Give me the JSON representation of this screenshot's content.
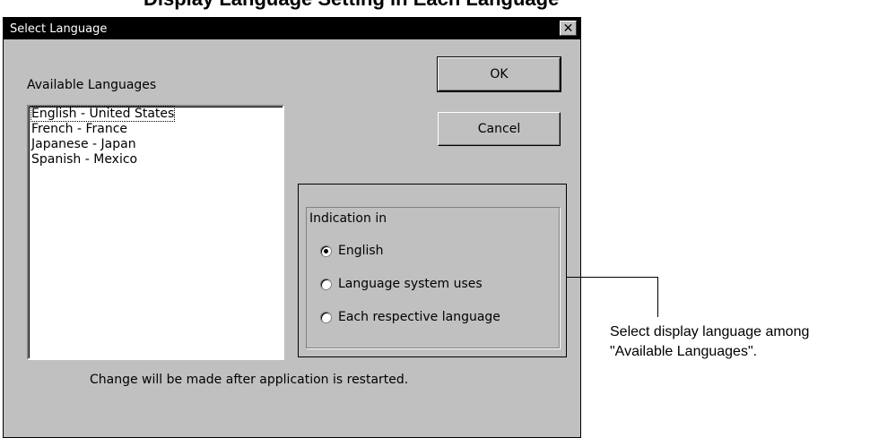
{
  "heading": "Display Language Setting in Each Language",
  "dialog": {
    "title": "Select Language",
    "close_symbol": "✕",
    "available_label": "Available Languages",
    "languages": [
      "English - United States",
      "French - France",
      "Japanese - Japan",
      "Spanish - Mexico"
    ],
    "selected_language": "English - United States",
    "ok_label": "OK",
    "cancel_label": "Cancel",
    "indication_legend": "Indication in",
    "radio_options": [
      "English",
      "Language system uses",
      "Each respective language"
    ],
    "selected_option": "English",
    "restart_note": "Change will be made after application is restarted."
  },
  "callout": {
    "line1": "Select display language among",
    "line2": "\"Available Languages\"."
  }
}
